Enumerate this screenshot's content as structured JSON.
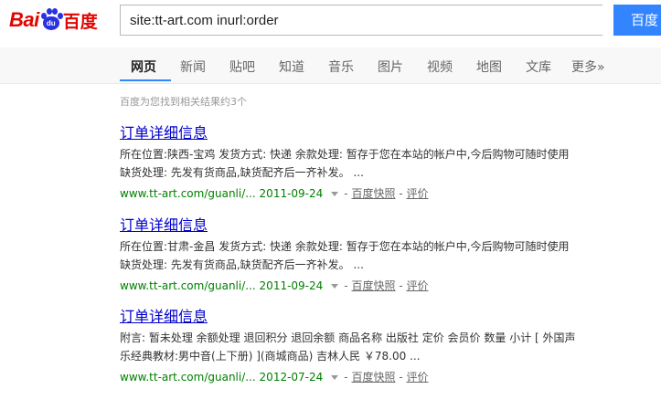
{
  "logo": {
    "latin": "Bai",
    "paw_text": "du",
    "chinese": "百度"
  },
  "search": {
    "query": "site:tt-art.com inurl:order",
    "button_label": "百度"
  },
  "tabs": [
    {
      "label": "网页",
      "active": true
    },
    {
      "label": "新闻"
    },
    {
      "label": "贴吧"
    },
    {
      "label": "知道"
    },
    {
      "label": "音乐"
    },
    {
      "label": "图片"
    },
    {
      "label": "视频"
    },
    {
      "label": "地图"
    },
    {
      "label": "文库"
    },
    {
      "label": "更多»"
    }
  ],
  "result_count": "百度为您找到相关结果约3个",
  "results": [
    {
      "title": "订单详细信息",
      "abstract_1": "所在位置:陕西-宝鸡 发货方式: 快递 余款处理: 暂存于您在本站的帐户中,今后购物可随时使用",
      "abstract_2": "缺货处理: 先发有货商品,缺货配齐后一齐补发。 ...",
      "url": "www.tt-art.com/guanli/...",
      "date": "2011-09-24",
      "dash": "-",
      "snapshot": "百度快照",
      "review": "评价"
    },
    {
      "title": "订单详细信息",
      "abstract_1": "所在位置:甘肃-金昌 发货方式: 快递 余款处理: 暂存于您在本站的帐户中,今后购物可随时使用",
      "abstract_2": "缺货处理: 先发有货商品,缺货配齐后一齐补发。 ...",
      "url": "www.tt-art.com/guanli/...",
      "date": "2011-09-24",
      "dash": "-",
      "snapshot": "百度快照",
      "review": "评价"
    },
    {
      "title": "订单详细信息",
      "abstract_1": "附言: 暂未处理 余额处理 退回积分 退回余额 商品名称 出版社 定价 会员价 数量 小计 [ 外国声",
      "abstract_2": "乐经典教材:男中音(上下册) ](商城商品) 吉林人民 ￥78.00 ...",
      "url": "www.tt-art.com/guanli/...",
      "date": "2012-07-24",
      "dash": "-",
      "snapshot": "百度快照",
      "review": "评价"
    }
  ],
  "colors": {
    "brand_red": "#e10601",
    "brand_blue": "#2932e1",
    "button_blue": "#3385ff",
    "link_blue": "#0000cc",
    "url_green": "#008000"
  }
}
